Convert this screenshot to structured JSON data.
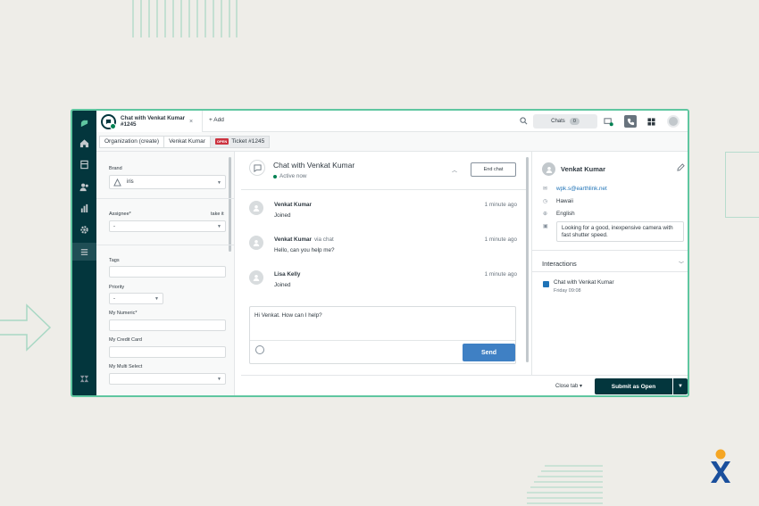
{
  "window": {
    "tab_title": "Chat with Venkat Kumar #1245",
    "tab_close": "×",
    "add_label": "+ Add",
    "chats_label": "Chats",
    "chats_count": "0"
  },
  "breadcrumbs": [
    {
      "label": "Organization (create)"
    },
    {
      "label": "Venkat Kumar"
    },
    {
      "label": "Ticket #1245",
      "badge": "OPEN"
    }
  ],
  "properties": {
    "brand_label": "Brand",
    "brand_value": "iris",
    "assignee_label": "Assignee*",
    "take_it": "take it",
    "assignee_value": "-",
    "tags_label": "Tags",
    "tags_value": "",
    "priority_label": "Priority",
    "priority_value": "-",
    "numeric_label": "My Numeric*",
    "credit_label": "My Credit Card",
    "multiselect_label": "My Multi Select"
  },
  "chat": {
    "title": "Chat with Venkat Kumar",
    "status": "Active now",
    "end_chat": "End chat",
    "messages": [
      {
        "name": "Venkat Kumar",
        "via": "",
        "time": "1 minute ago",
        "body": "Joined"
      },
      {
        "name": "Venkat Kumar",
        "via": "via chat",
        "time": "1 minute ago",
        "body": "Hello, can you help me?"
      },
      {
        "name": "Lisa Kelly",
        "via": "",
        "time": "1 minute ago",
        "body": "Joined"
      }
    ],
    "composer_text": "Hi Venkat. How can I help?",
    "send_label": "Send"
  },
  "context": {
    "name": "Venkat Kumar",
    "email": "wpk.s@earthlink.net",
    "location": "Hawaii",
    "language": "English",
    "notes": "Looking for a good, inexpensive camera with fast shutter speed.",
    "interactions_title": "Interactions",
    "interaction": {
      "title": "Chat with Venkat Kumar",
      "time": "Friday 09:08"
    }
  },
  "footer": {
    "close_tab": "Close tab",
    "submit": "Submit as Open"
  },
  "colors": {
    "frame_border": "#5fc6a0",
    "nav_bg": "#03363d",
    "send_button": "#3f80c4",
    "open_badge": "#cc3340",
    "online": "#038153"
  },
  "icons": [
    "zendesk-logo-icon",
    "home-icon",
    "views-icon",
    "customers-icon",
    "reports-icon",
    "admin-gear-icon",
    "list-icon",
    "zendesk-z-icon",
    "search-icon",
    "chat-add-icon",
    "phone-icon",
    "apps-grid-icon",
    "edit-icon",
    "email-icon",
    "location-icon",
    "globe-icon",
    "note-icon",
    "emoji-icon"
  ]
}
